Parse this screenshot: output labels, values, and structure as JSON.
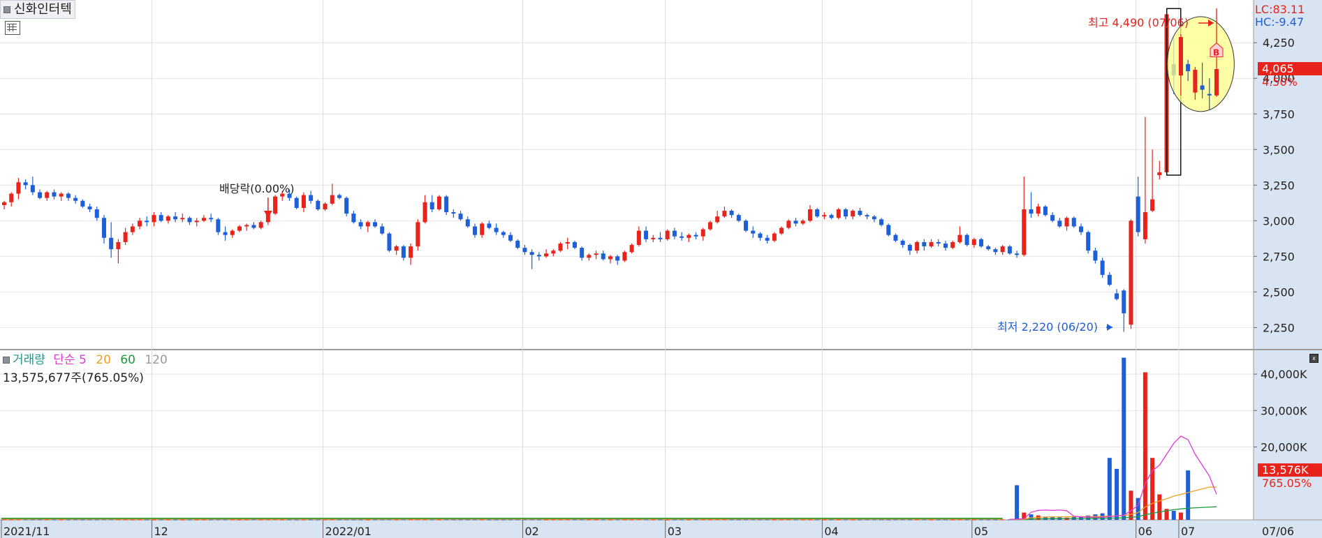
{
  "stock": {
    "name": "신화인터텍"
  },
  "price_panel": {
    "lc_label": "LC:83.11",
    "hc_label": "HC:-9.47",
    "high_annotation": "최고 4,490 (07/06)",
    "low_annotation": "최저 2,220 (06/20)",
    "dividend_annotation": "배당락(0.00%)",
    "current_price": "4,065",
    "current_change": "4.50%",
    "y_ticks": [
      "4,250",
      "4,000",
      "3,750",
      "3,500",
      "3,250",
      "3,000",
      "2,750",
      "2,500",
      "2,250"
    ],
    "badge": "B"
  },
  "volume_panel": {
    "label": "거래량",
    "ma_label": "단순",
    "ma_periods": [
      "5",
      "20",
      "60",
      "120"
    ],
    "current_volume": "13,575,677주(765.05%)",
    "current_volume_tag": "13,576K",
    "current_volume_pct": "765.05%",
    "y_ticks": [
      "40,000K",
      "30,000K",
      "20,000K"
    ]
  },
  "x_axis": {
    "labels": [
      "2021/11",
      "12",
      "2022/01",
      "02",
      "03",
      "04",
      "05",
      "06",
      "07",
      "07/06"
    ]
  },
  "colors": {
    "up": "#e8231c",
    "down": "#1d5fd6",
    "ma5": "#e03ad6",
    "ma20": "#f0a020",
    "ma60": "#1a9a3a",
    "ma120": "#9a9a9a",
    "axis_bg": "#d9e4f2",
    "highlight": "#ffff88"
  },
  "chart_data": {
    "type": "candlestick",
    "y_price_range": [
      2100,
      4550
    ],
    "y_volume_range": [
      0,
      45000
    ],
    "price_unit": "KRW",
    "volume_unit": "K shares",
    "candles": [
      [
        3110,
        3140,
        3080,
        3130
      ],
      [
        3130,
        3200,
        3100,
        3190
      ],
      [
        3190,
        3300,
        3150,
        3270
      ],
      [
        3270,
        3290,
        3220,
        3250
      ],
      [
        3250,
        3310,
        3180,
        3200
      ],
      [
        3200,
        3220,
        3150,
        3160
      ],
      [
        3160,
        3210,
        3140,
        3200
      ],
      [
        3200,
        3220,
        3150,
        3170
      ],
      [
        3170,
        3200,
        3140,
        3190
      ],
      [
        3190,
        3200,
        3140,
        3160
      ],
      [
        3160,
        3180,
        3120,
        3140
      ],
      [
        3140,
        3150,
        3090,
        3100
      ],
      [
        3100,
        3120,
        3060,
        3080
      ],
      [
        3080,
        3100,
        3000,
        3020
      ],
      [
        3020,
        3040,
        2840,
        2880
      ],
      [
        2880,
        2990,
        2740,
        2800
      ],
      [
        2800,
        2870,
        2700,
        2850
      ],
      [
        2850,
        2950,
        2830,
        2920
      ],
      [
        2920,
        2980,
        2900,
        2960
      ],
      [
        2960,
        3020,
        2940,
        3000
      ],
      [
        3000,
        3030,
        2960,
        2990
      ],
      [
        2990,
        3060,
        2960,
        3040
      ],
      [
        3040,
        3060,
        2990,
        3000
      ],
      [
        3000,
        3040,
        2980,
        3030
      ],
      [
        3030,
        3060,
        2990,
        3010
      ],
      [
        3010,
        3050,
        2990,
        3020
      ],
      [
        3020,
        3030,
        2970,
        2990
      ],
      [
        2990,
        3020,
        2960,
        3000
      ],
      [
        3000,
        3040,
        2990,
        3020
      ],
      [
        3020,
        3050,
        2990,
        3010
      ],
      [
        3010,
        3020,
        2900,
        2920
      ],
      [
        2920,
        2960,
        2860,
        2900
      ],
      [
        2900,
        2940,
        2880,
        2930
      ],
      [
        2930,
        2970,
        2920,
        2960
      ],
      [
        2960,
        2980,
        2930,
        2970
      ],
      [
        2970,
        2990,
        2940,
        2950
      ],
      [
        2950,
        3000,
        2940,
        2990
      ],
      [
        2990,
        3060,
        2970,
        3050
      ],
      [
        3050,
        3180,
        3040,
        3170
      ],
      [
        3170,
        3210,
        3140,
        3190
      ],
      [
        3190,
        3220,
        3140,
        3160
      ],
      [
        3160,
        3170,
        3080,
        3090
      ],
      [
        3090,
        3200,
        3060,
        3180
      ],
      [
        3180,
        3210,
        3120,
        3140
      ],
      [
        3140,
        3150,
        3070,
        3080
      ],
      [
        3080,
        3130,
        3070,
        3120
      ],
      [
        3120,
        3260,
        3110,
        3180
      ],
      [
        3180,
        3190,
        3150,
        3160
      ],
      [
        3160,
        3170,
        3030,
        3050
      ],
      [
        3050,
        3070,
        2980,
        2990
      ],
      [
        2990,
        3010,
        2940,
        2960
      ],
      [
        2960,
        3000,
        2920,
        2990
      ],
      [
        2990,
        3010,
        2950,
        2960
      ],
      [
        2960,
        2980,
        2900,
        2910
      ],
      [
        2910,
        2920,
        2780,
        2790
      ],
      [
        2790,
        2830,
        2760,
        2820
      ],
      [
        2820,
        2830,
        2720,
        2740
      ],
      [
        2740,
        2840,
        2690,
        2820
      ],
      [
        2820,
        3010,
        2790,
        2990
      ],
      [
        2990,
        3180,
        2980,
        3130
      ],
      [
        3130,
        3180,
        3060,
        3080
      ],
      [
        3080,
        3180,
        3070,
        3170
      ],
      [
        3170,
        3180,
        3040,
        3060
      ],
      [
        3060,
        3080,
        3020,
        3050
      ],
      [
        3050,
        3070,
        3000,
        3010
      ],
      [
        3010,
        3030,
        2950,
        2960
      ],
      [
        2960,
        2980,
        2880,
        2900
      ],
      [
        2900,
        2990,
        2880,
        2980
      ],
      [
        2980,
        3000,
        2940,
        2950
      ],
      [
        2950,
        2980,
        2900,
        2920
      ],
      [
        2920,
        2930,
        2880,
        2900
      ],
      [
        2900,
        2920,
        2850,
        2860
      ],
      [
        2860,
        2870,
        2800,
        2810
      ],
      [
        2810,
        2830,
        2760,
        2780
      ],
      [
        2780,
        2800,
        2660,
        2760
      ],
      [
        2760,
        2780,
        2720,
        2750
      ],
      [
        2750,
        2800,
        2740,
        2770
      ],
      [
        2770,
        2800,
        2750,
        2790
      ],
      [
        2790,
        2850,
        2780,
        2840
      ],
      [
        2840,
        2880,
        2800,
        2850
      ],
      [
        2850,
        2860,
        2800,
        2810
      ],
      [
        2810,
        2820,
        2720,
        2740
      ],
      [
        2740,
        2770,
        2720,
        2760
      ],
      [
        2760,
        2790,
        2730,
        2770
      ],
      [
        2770,
        2790,
        2720,
        2730
      ],
      [
        2730,
        2760,
        2700,
        2750
      ],
      [
        2750,
        2760,
        2690,
        2720
      ],
      [
        2720,
        2790,
        2710,
        2780
      ],
      [
        2780,
        2840,
        2770,
        2830
      ],
      [
        2830,
        2960,
        2820,
        2930
      ],
      [
        2930,
        2960,
        2850,
        2870
      ],
      [
        2870,
        2900,
        2850,
        2880
      ],
      [
        2880,
        2920,
        2850,
        2870
      ],
      [
        2870,
        2940,
        2860,
        2930
      ],
      [
        2930,
        2950,
        2870,
        2890
      ],
      [
        2890,
        2920,
        2860,
        2880
      ],
      [
        2880,
        2910,
        2850,
        2900
      ],
      [
        2900,
        2920,
        2870,
        2890
      ],
      [
        2890,
        2950,
        2860,
        2940
      ],
      [
        2940,
        3000,
        2930,
        2990
      ],
      [
        2990,
        3070,
        2980,
        3030
      ],
      [
        3030,
        3100,
        3020,
        3070
      ],
      [
        3070,
        3080,
        3020,
        3040
      ],
      [
        3040,
        3050,
        2990,
        3000
      ],
      [
        3000,
        3010,
        2920,
        2930
      ],
      [
        2930,
        2960,
        2880,
        2910
      ],
      [
        2910,
        2920,
        2860,
        2880
      ],
      [
        2880,
        2900,
        2840,
        2860
      ],
      [
        2860,
        2920,
        2850,
        2910
      ],
      [
        2910,
        2960,
        2900,
        2950
      ],
      [
        2950,
        3010,
        2940,
        3000
      ],
      [
        3000,
        3020,
        2960,
        2980
      ],
      [
        2980,
        3010,
        2970,
        3000
      ],
      [
        3000,
        3110,
        2990,
        3080
      ],
      [
        3080,
        3090,
        3020,
        3030
      ],
      [
        3030,
        3060,
        3010,
        3040
      ],
      [
        3040,
        3050,
        3010,
        3020
      ],
      [
        3020,
        3090,
        3010,
        3080
      ],
      [
        3080,
        3090,
        3010,
        3030
      ],
      [
        3030,
        3080,
        3010,
        3070
      ],
      [
        3070,
        3090,
        3030,
        3040
      ],
      [
        3040,
        3050,
        3010,
        3030
      ],
      [
        3030,
        3040,
        2990,
        3010
      ],
      [
        3010,
        3020,
        2960,
        2970
      ],
      [
        2970,
        2980,
        2890,
        2900
      ],
      [
        2900,
        2910,
        2850,
        2860
      ],
      [
        2860,
        2870,
        2810,
        2830
      ],
      [
        2830,
        2840,
        2760,
        2790
      ],
      [
        2790,
        2860,
        2770,
        2850
      ],
      [
        2850,
        2870,
        2790,
        2820
      ],
      [
        2820,
        2870,
        2810,
        2850
      ],
      [
        2850,
        2870,
        2820,
        2840
      ],
      [
        2840,
        2860,
        2790,
        2810
      ],
      [
        2810,
        2860,
        2800,
        2850
      ],
      [
        2850,
        2960,
        2840,
        2900
      ],
      [
        2900,
        2910,
        2820,
        2830
      ],
      [
        2830,
        2880,
        2810,
        2870
      ],
      [
        2870,
        2880,
        2810,
        2820
      ],
      [
        2820,
        2830,
        2790,
        2800
      ],
      [
        2800,
        2810,
        2760,
        2780
      ],
      [
        2780,
        2830,
        2760,
        2820
      ],
      [
        2820,
        2830,
        2760,
        2770
      ],
      [
        2770,
        2790,
        2740,
        2760
      ],
      [
        2760,
        3310,
        2750,
        3080
      ],
      [
        3080,
        3200,
        3020,
        3050
      ],
      [
        3050,
        3120,
        3030,
        3100
      ],
      [
        3100,
        3110,
        3030,
        3040
      ],
      [
        3040,
        3060,
        2990,
        3000
      ],
      [
        3000,
        3020,
        2950,
        2960
      ],
      [
        2960,
        3030,
        2930,
        3020
      ],
      [
        3020,
        3030,
        2950,
        2960
      ],
      [
        2960,
        2980,
        2900,
        2920
      ],
      [
        2920,
        2930,
        2770,
        2790
      ],
      [
        2790,
        2810,
        2700,
        2720
      ],
      [
        2720,
        2740,
        2600,
        2620
      ],
      [
        2620,
        2640,
        2540,
        2550
      ],
      [
        2490,
        2520,
        2440,
        2450
      ],
      [
        2510,
        2520,
        2220,
        2350
      ],
      [
        2270,
        3010,
        2240,
        3000
      ],
      [
        3170,
        3310,
        2890,
        2920
      ],
      [
        2870,
        3730,
        2840,
        3060
      ],
      [
        3070,
        3500,
        3060,
        3150
      ],
      [
        3320,
        3420,
        3290,
        3340
      ],
      [
        3340,
        4390,
        3320,
        4450
      ],
      [
        4100,
        4290,
        3890,
        4020
      ],
      [
        4020,
        4310,
        3880,
        4290
      ],
      [
        4100,
        4130,
        3980,
        4050
      ],
      [
        3900,
        4080,
        3850,
        4060
      ],
      [
        3950,
        4110,
        3860,
        3920
      ],
      [
        3890,
        4000,
        3780,
        3880
      ],
      [
        3880,
        4490,
        3870,
        4065
      ]
    ],
    "volume_k": [
      120,
      110,
      130,
      120,
      110,
      100,
      120,
      110,
      100,
      90,
      100,
      90,
      110,
      100,
      120,
      140,
      130,
      120,
      110,
      100,
      100,
      90,
      100,
      110,
      100,
      90,
      100,
      90,
      100,
      110,
      120,
      110,
      100,
      90,
      100,
      110,
      100,
      120,
      140,
      110,
      100,
      90,
      110,
      100,
      90,
      100,
      120,
      100,
      110,
      90,
      100,
      90,
      100,
      110,
      130,
      120,
      110,
      130,
      140,
      130,
      110,
      100,
      120,
      110,
      100,
      90,
      110,
      100,
      90,
      100,
      90,
      100,
      110,
      100,
      120,
      100,
      90,
      100,
      110,
      120,
      100,
      110,
      100,
      90,
      100,
      110,
      120,
      100,
      110,
      150,
      120,
      100,
      110,
      90,
      100,
      110,
      90,
      100,
      110,
      120,
      130,
      120,
      110,
      100,
      110,
      120,
      100,
      110,
      90,
      100,
      120,
      100,
      110,
      100,
      90,
      100,
      110,
      100,
      120,
      110,
      100,
      110,
      120,
      100,
      90,
      100,
      110,
      100,
      120,
      110,
      100,
      90,
      100,
      110,
      120,
      100,
      110,
      100,
      90,
      100,
      100,
      110,
      9500,
      2000,
      1500,
      1200,
      900,
      800,
      700,
      600,
      800,
      900,
      1200,
      1500,
      1800,
      17000,
      14000,
      44500,
      8000,
      6000,
      40500,
      17000,
      7000,
      3000,
      2500,
      2000,
      13576
    ],
    "ma5_k": [
      150,
      200,
      300,
      2100,
      2600,
      2700,
      2600,
      2700,
      2500,
      1000,
      800,
      750,
      700,
      750,
      900,
      1100,
      1300,
      2500,
      4000,
      10000,
      13500,
      15000,
      18000,
      21000,
      23000,
      22000,
      18000,
      15000,
      12000,
      7000
    ],
    "ma20_k": [
      100,
      120,
      140,
      600,
      700,
      750,
      800,
      820,
      850,
      870,
      880,
      900,
      920,
      950,
      1000,
      1100,
      1200,
      1500,
      2000,
      3500,
      4500,
      5200,
      5800,
      6500,
      7000,
      7500,
      8000,
      8500,
      9000,
      9000
    ],
    "ma60_k": [
      100,
      100,
      110,
      250,
      280,
      300,
      320,
      340,
      360,
      380,
      400,
      420,
      440,
      460,
      480,
      520,
      560,
      700,
      900,
      1400,
      1800,
      2200,
      2500,
      2800,
      3000,
      3200,
      3300,
      3400,
      3500,
      3600
    ]
  }
}
